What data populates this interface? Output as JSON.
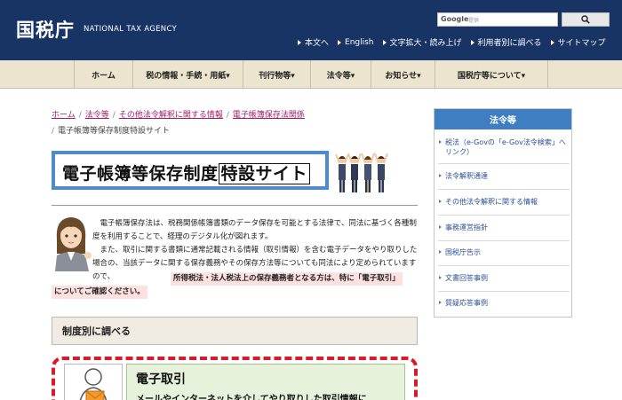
{
  "header": {
    "brand_jp": "国税庁",
    "brand_en": "NATIONAL TAX AGENCY",
    "search_brand": "Google",
    "search_sub": "提供",
    "util_links": [
      "本文へ",
      "English",
      "文字拡大・読み上げ",
      "利用者別に調べる",
      "サイトマップ"
    ]
  },
  "nav": {
    "items": [
      "ホーム",
      "税の情報・手続・用紙▾",
      "刊行物等▾",
      "法令等▾",
      "お知らせ▾",
      "国税庁等について▾"
    ]
  },
  "breadcrumb": {
    "items": [
      "ホーム",
      "法令等",
      "その他法令解釈に関する情報",
      "電子帳簿保存法関係"
    ],
    "current": "電子帳簿等保存制度特設サイト"
  },
  "title": {
    "main": "電子帳簿等保存制度",
    "sub": "特設サイト"
  },
  "intro": {
    "para1": "電子帳簿保存法は、税務関係帳簿書類のデータ保存を可能とする法律で、同法に基づく各種制度を利用することで、経理のデジタル化が図れます。",
    "para2": "また、取引に関する書類に通常記載される情報（取引情報）を含む電子データをやり取りした場合の、当該データに関する保存義務やその保存方法等についても同法により定められていますので、",
    "notice1": "所得税法・法人税法上の保存義務者となる方は、特に「電子取引」",
    "notice2": "についてご確認ください。"
  },
  "section": {
    "heading": "制度別に調べる"
  },
  "card": {
    "title": "電子取引",
    "desc": "メールやインターネットを介してやり取りした取引情報に"
  },
  "sidebar": {
    "heading": "法令等",
    "items": [
      "税法（e-Govの「e-Gov法令検索」へリンク）",
      "法令解釈通達",
      "その他法令解釈に関する情報",
      "事務運営指針",
      "国税庁告示",
      "文書回答事例",
      "質疑応答事例"
    ]
  },
  "colors": {
    "header_bg": "#173465",
    "nav_bg": "#ece4cf",
    "link": "#a02066",
    "title_border": "#4d8cc9",
    "sidebar_head": "#3f7fc1",
    "dashed_border": "#d91a2a",
    "card_green": "#e6f2dc"
  }
}
